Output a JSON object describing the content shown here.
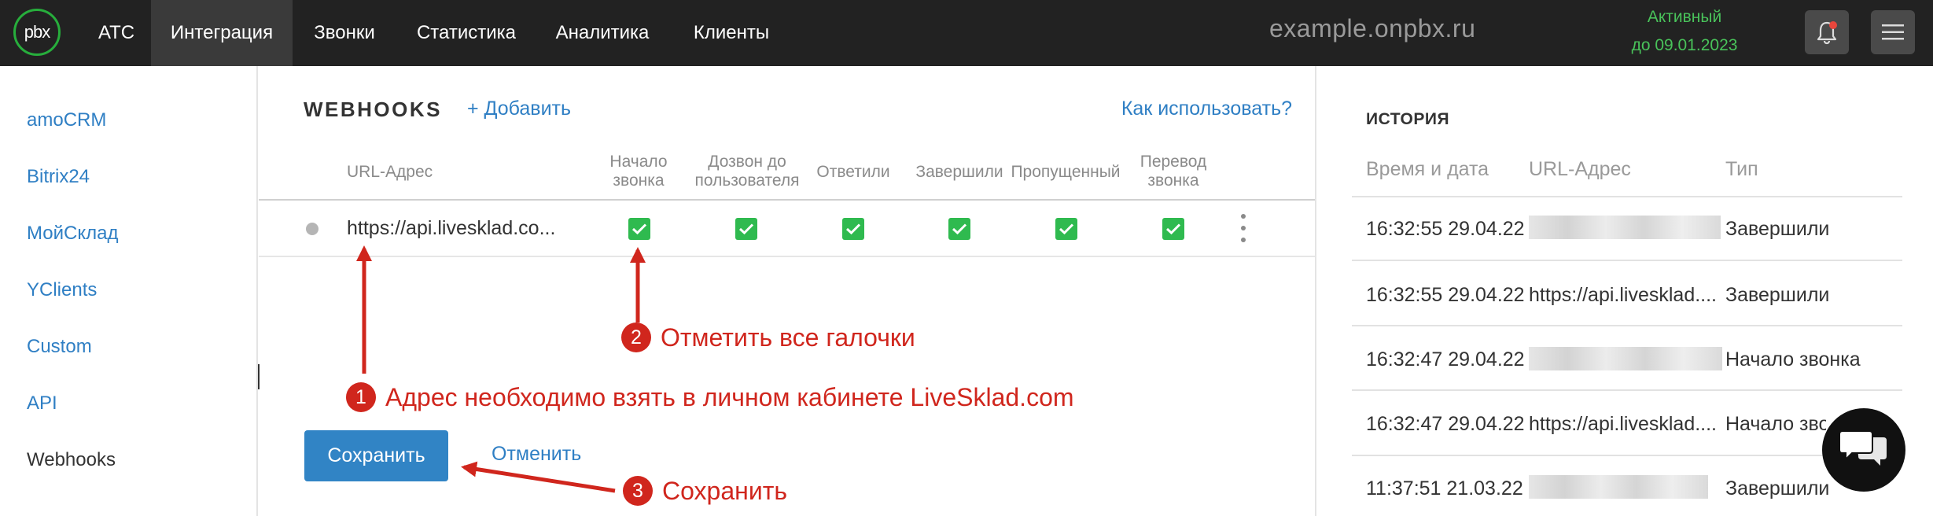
{
  "app": {
    "logo_text": "pbx",
    "nav": [
      {
        "label": "АТС",
        "active": false
      },
      {
        "label": "Интеграция",
        "active": true
      },
      {
        "label": "Звонки",
        "active": false
      },
      {
        "label": "Статистика",
        "active": false
      },
      {
        "label": "Аналитика",
        "active": false
      },
      {
        "label": "Клиенты",
        "active": false
      }
    ],
    "domain": "example.onpbx.ru",
    "status_line1": "Активный",
    "status_line2": "до 09.01.2023",
    "bell_icon": "bell-icon",
    "menu_icon": "hamburger-menu-icon"
  },
  "sidebar": {
    "items": [
      {
        "label": "amoCRM"
      },
      {
        "label": "Bitrix24"
      },
      {
        "label": "МойСклад"
      },
      {
        "label": "YClients"
      },
      {
        "label": "Custom"
      },
      {
        "label": "API"
      },
      {
        "label": "Webhooks",
        "current": true
      }
    ]
  },
  "webhooks": {
    "title": "WEBHOOKS",
    "add_label": "+ Добавить",
    "help_label": "Как использовать?",
    "columns": {
      "url": "URL-Адрес",
      "call_start": [
        "Начало",
        "звонка"
      ],
      "dial_user": [
        "Дозвон до",
        "пользователя"
      ],
      "answered": "Ответили",
      "finished": "Завершили",
      "missed": "Пропущенный",
      "transfer": [
        "Перевод",
        "звонка"
      ]
    },
    "row": {
      "url": "https://api.livesklad.co...",
      "checked": [
        true,
        true,
        true,
        true,
        true,
        true
      ]
    },
    "save_label": "Сохранить",
    "cancel_label": "Отменить"
  },
  "annotations": [
    {
      "number": "1",
      "text": "Адрес необходимо взять в личном кабинете LiveSklad.com"
    },
    {
      "number": "2",
      "text": "Отметить все галочки"
    },
    {
      "number": "3",
      "text": "Сохранить"
    }
  ],
  "history": {
    "title": "ИСТОРИЯ",
    "headers": {
      "datetime": "Время и дата",
      "url": "URL-Адрес",
      "type": "Тип"
    },
    "rows": [
      {
        "datetime": "16:32:55 29.04.22",
        "url": "",
        "type": "Завершили"
      },
      {
        "datetime": "16:32:55 29.04.22",
        "url": "https://api.livesklad....",
        "type": "Завершили"
      },
      {
        "datetime": "16:32:47 29.04.22",
        "url": "",
        "type": "Начало звонка"
      },
      {
        "datetime": "16:32:47 29.04.22",
        "url": "https://api.livesklad....",
        "type": "Начало звонка"
      },
      {
        "datetime": "11:37:51 21.03.22",
        "url": "",
        "type": "Завершили"
      }
    ]
  },
  "colors": {
    "topbar": "#222222",
    "accent_link": "#2f7fc4",
    "checkbox": "#2fba4f",
    "annotation": "#d0261d",
    "status": "#49c25a"
  }
}
